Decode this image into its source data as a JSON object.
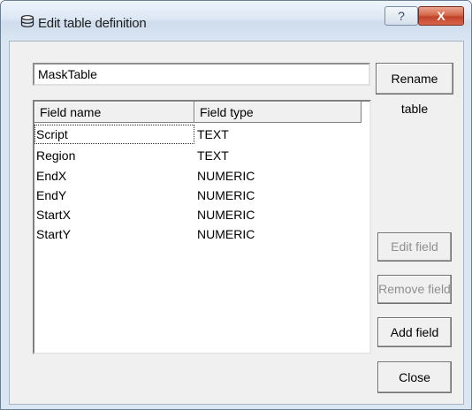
{
  "window": {
    "title": "Edit table definition",
    "icon": "database-icon",
    "help_label": "?",
    "close_label": "X"
  },
  "table_name": {
    "value": "MaskTable"
  },
  "buttons": {
    "rename": "Rename table",
    "edit_field": "Edit field",
    "remove_field": "Remove field",
    "add_field": "Add field",
    "close": "Close"
  },
  "fields_list": {
    "columns": [
      "Field name",
      "Field type"
    ],
    "rows": [
      {
        "name": "Script",
        "type": "TEXT"
      },
      {
        "name": "Region",
        "type": "TEXT"
      },
      {
        "name": "EndX",
        "type": "NUMERIC"
      },
      {
        "name": "EndY",
        "type": "NUMERIC"
      },
      {
        "name": "StartX",
        "type": "NUMERIC"
      },
      {
        "name": "StartY",
        "type": "NUMERIC"
      }
    ]
  }
}
